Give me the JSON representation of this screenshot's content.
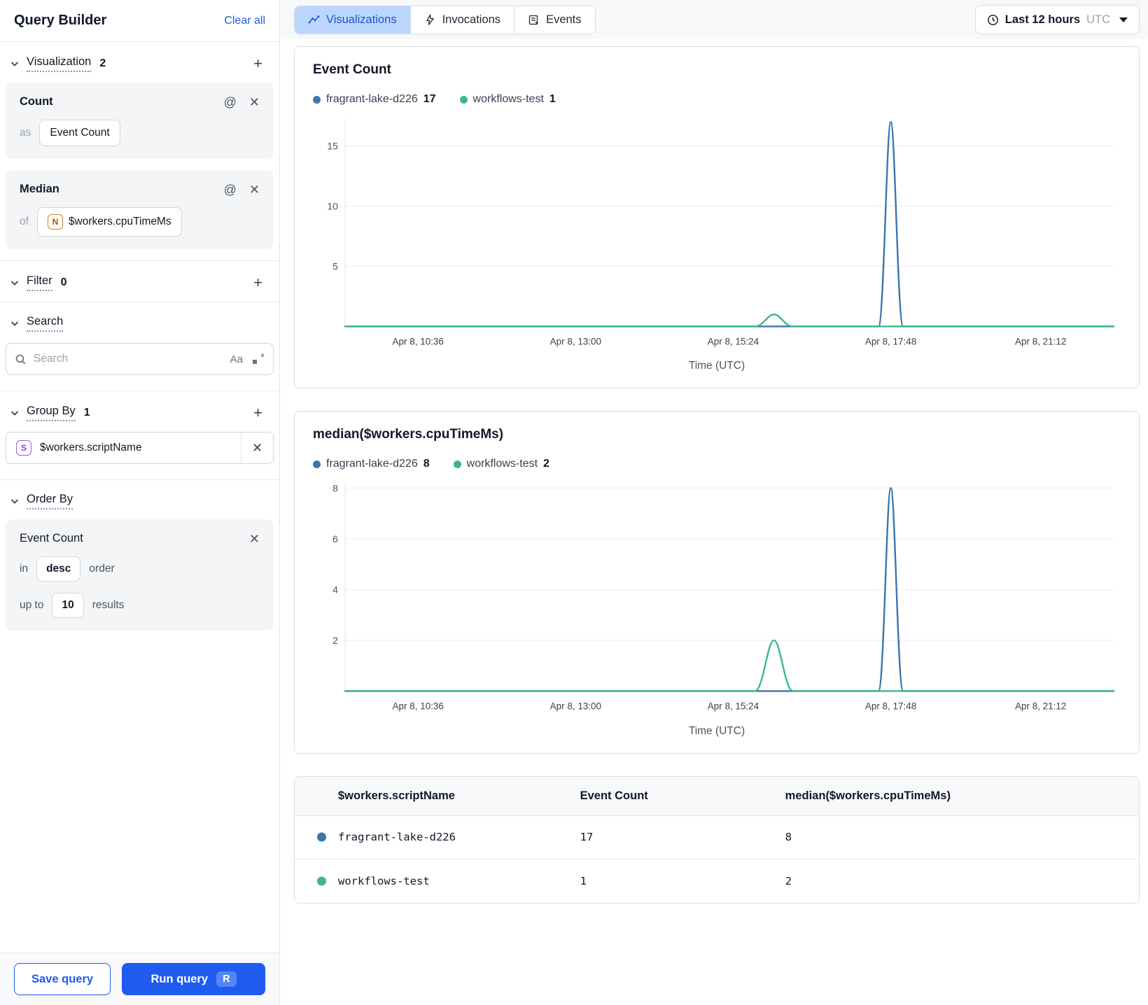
{
  "colors": {
    "series_blue": "#3C76AB",
    "series_green": "#3CB78B",
    "primary_blue": "#1E5BEF",
    "active_tab_bg": "#BCD7FE",
    "active_tab_text": "#1D51D0"
  },
  "sidebar": {
    "title": "Query Builder",
    "clear_all": "Clear all",
    "visualization": {
      "label": "Visualization",
      "count": "2"
    },
    "count_card": {
      "title": "Count",
      "as_label": "as",
      "value": "Event Count"
    },
    "median_card": {
      "title": "Median",
      "of_label": "of",
      "badge": "N",
      "value": "$workers.cpuTimeMs"
    },
    "filter": {
      "label": "Filter",
      "count": "0"
    },
    "search": {
      "label": "Search",
      "placeholder": "Search",
      "case_icon": "Aa"
    },
    "group_by": {
      "label": "Group By",
      "count": "1",
      "badge": "S",
      "value": "$workers.scriptName"
    },
    "order_by": {
      "label": "Order By",
      "field": "Event Count",
      "in_label": "in",
      "direction": "desc",
      "order_label": "order",
      "up_to_label": "up to",
      "limit": "10",
      "results_label": "results"
    },
    "save_button": "Save query",
    "run_button": "Run query",
    "run_shortcut": "R"
  },
  "topbar": {
    "tabs": [
      {
        "label": "Visualizations"
      },
      {
        "label": "Invocations"
      },
      {
        "label": "Events"
      }
    ],
    "time_range": {
      "label": "Last 12 hours",
      "timezone": "UTC"
    }
  },
  "chart_data": [
    {
      "type": "line",
      "title": "Event Count",
      "xlabel": "Time (UTC)",
      "x_tick_labels": [
        "Apr 8, 10:36",
        "Apr 8, 13:00",
        "Apr 8, 15:24",
        "Apr 8, 17:48",
        "Apr 8, 21:12"
      ],
      "x_tick_fracs": [
        0.095,
        0.3,
        0.505,
        0.71,
        0.905
      ],
      "y_ticks": [
        5,
        10,
        15
      ],
      "ylim": [
        0,
        17.3
      ],
      "grid": true,
      "legend_position": "top",
      "series": [
        {
          "name": "fragrant-lake-d226",
          "total": "17",
          "color": "#3C76AB",
          "baseline": 0,
          "peaks": [
            {
              "x_frac": 0.71,
              "value": 17,
              "half_width_frac": 0.016
            }
          ]
        },
        {
          "name": "workflows-test",
          "total": "1",
          "color": "#3CB78B",
          "baseline": 0,
          "peaks": [
            {
              "x_frac": 0.558,
              "value": 1,
              "half_width_frac": 0.025
            }
          ]
        }
      ]
    },
    {
      "type": "line",
      "title": "median($workers.cpuTimeMs)",
      "xlabel": "Time (UTC)",
      "x_tick_labels": [
        "Apr 8, 10:36",
        "Apr 8, 13:00",
        "Apr 8, 15:24",
        "Apr 8, 17:48",
        "Apr 8, 21:12"
      ],
      "x_tick_fracs": [
        0.095,
        0.3,
        0.505,
        0.71,
        0.905
      ],
      "y_ticks": [
        2,
        4,
        6,
        8
      ],
      "ylim": [
        0,
        8.2
      ],
      "grid": true,
      "legend_position": "top",
      "series": [
        {
          "name": "fragrant-lake-d226",
          "total": "8",
          "color": "#3C76AB",
          "baseline": 0,
          "peaks": [
            {
              "x_frac": 0.71,
              "value": 8,
              "half_width_frac": 0.016
            }
          ]
        },
        {
          "name": "workflows-test",
          "total": "2",
          "color": "#3CB78B",
          "baseline": 0,
          "peaks": [
            {
              "x_frac": 0.558,
              "value": 2,
              "half_width_frac": 0.025
            }
          ]
        }
      ]
    }
  ],
  "table": {
    "columns": [
      "$workers.scriptName",
      "Event Count",
      "median($workers.cpuTimeMs)"
    ],
    "rows": [
      {
        "color": "#3C76AB",
        "name": "fragrant-lake-d226",
        "event_count": "17",
        "median": "8"
      },
      {
        "color": "#3CB78B",
        "name": "workflows-test",
        "event_count": "1",
        "median": "2"
      }
    ]
  }
}
